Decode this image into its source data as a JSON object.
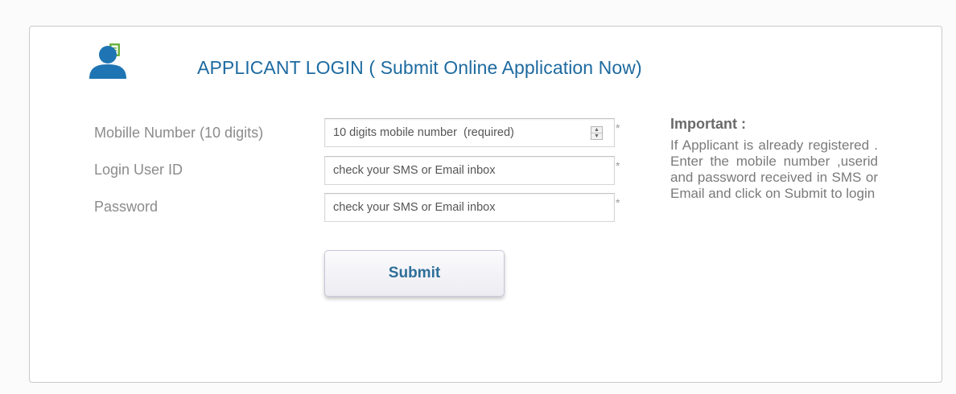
{
  "header": {
    "icon": "user-document-icon",
    "title": "APPLICANT LOGIN ( Submit Online Application Now)"
  },
  "form": {
    "mobile": {
      "label": "Mobille Number (10 digits)",
      "placeholder": "10 digits mobile number  (required)",
      "value": "",
      "required_mark": "*"
    },
    "userid": {
      "label": "Login User ID",
      "placeholder": "check your SMS or Email inbox",
      "value": "",
      "required_mark": "*"
    },
    "password": {
      "label": "Password",
      "placeholder": "check your SMS or Email inbox",
      "value": "",
      "required_mark": "*"
    },
    "submit_label": "Submit"
  },
  "important": {
    "title": "Important :",
    "text": "If Applicant is already registered . Enter the mobile number ,userid and password received in SMS or Email and click on Submit to login"
  },
  "colors": {
    "title": "#1d6aa0",
    "icon": "#1f75b3",
    "button_text": "#2e6f99",
    "label": "#8b8b8b"
  }
}
